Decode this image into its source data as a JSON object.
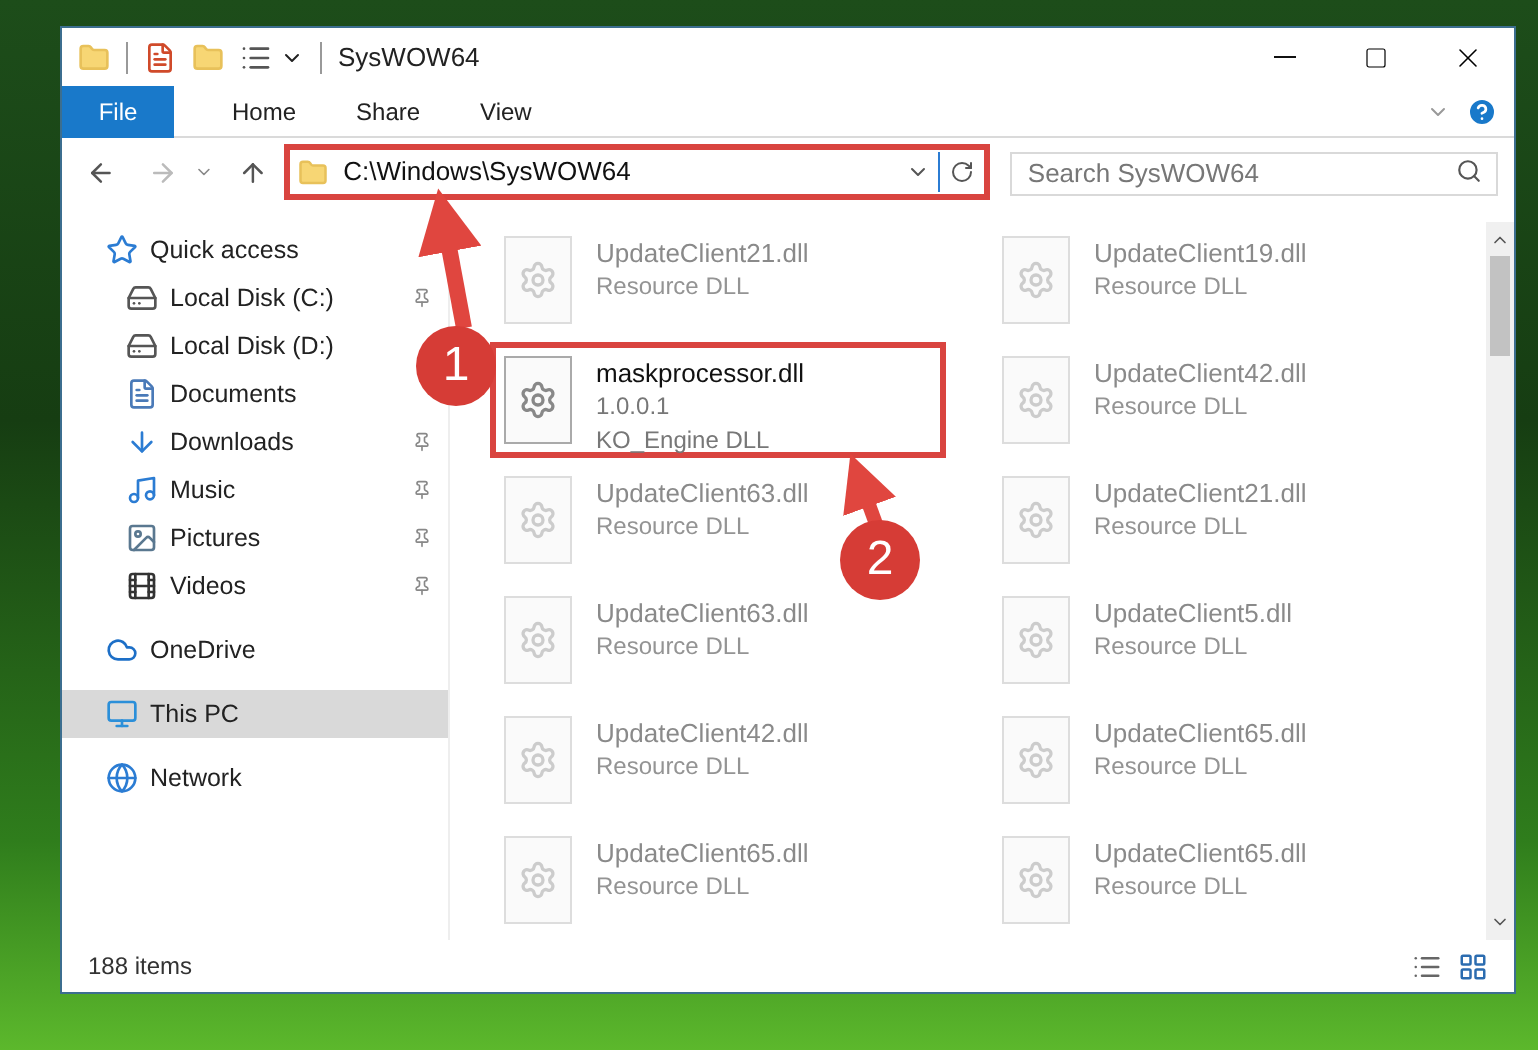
{
  "window": {
    "title": "SysWOW64"
  },
  "ribbon_tabs": [
    {
      "label": "File",
      "selected": true
    },
    {
      "label": "Home",
      "selected": false
    },
    {
      "label": "Share",
      "selected": false
    },
    {
      "label": "View",
      "selected": false
    }
  ],
  "address_bar": {
    "value": "C:\\Windows\\SysWOW64",
    "highlighted": true
  },
  "search": {
    "placeholder": "Search SysWOW64"
  },
  "sidebar": {
    "items": [
      {
        "label": "Quick access",
        "selected": false,
        "children": [
          {
            "label": "Local Disk (C:)",
            "selected": false,
            "pinned": true
          },
          {
            "label": "Local Disk (D:)",
            "selected": false,
            "pinned": false
          },
          {
            "label": "Documents",
            "selected": false,
            "pinned": false
          },
          {
            "label": "Downloads",
            "selected": false,
            "pinned": true
          },
          {
            "label": "Music",
            "selected": false,
            "pinned": true
          },
          {
            "label": "Pictures",
            "selected": false,
            "pinned": true
          },
          {
            "label": "Videos",
            "selected": false,
            "pinned": true
          }
        ]
      },
      {
        "label": "OneDrive",
        "selected": false
      },
      {
        "label": "This PC",
        "selected": true
      },
      {
        "label": "Network",
        "selected": false
      }
    ]
  },
  "files": [
    {
      "name": "UpdateClient21.dll",
      "lines": [
        "Resource DLL"
      ],
      "highlighted": false
    },
    {
      "name": "UpdateClient19.dll",
      "lines": [
        "Resource DLL"
      ],
      "highlighted": false
    },
    {
      "name": "maskprocessor.dll",
      "lines": [
        "1.0.0.1",
        "KO_Engine DLL"
      ],
      "highlighted": true
    },
    {
      "name": "UpdateClient42.dll",
      "lines": [
        "Resource DLL"
      ],
      "highlighted": false
    },
    {
      "name": "UpdateClient63.dll",
      "lines": [
        "Resource DLL"
      ],
      "highlighted": false
    },
    {
      "name": "UpdateClient21.dll",
      "lines": [
        "Resource DLL"
      ],
      "highlighted": false
    },
    {
      "name": "UpdateClient63.dll",
      "lines": [
        "Resource DLL"
      ],
      "highlighted": false
    },
    {
      "name": "UpdateClient5.dll",
      "lines": [
        "Resource DLL"
      ],
      "highlighted": false
    },
    {
      "name": "UpdateClient42.dll",
      "lines": [
        "Resource DLL"
      ],
      "highlighted": false
    },
    {
      "name": "UpdateClient65.dll",
      "lines": [
        "Resource DLL"
      ],
      "highlighted": false
    },
    {
      "name": "UpdateClient65.dll",
      "lines": [
        "Resource DLL"
      ],
      "highlighted": false
    },
    {
      "name": "UpdateClient65.dll",
      "lines": [
        "Resource DLL"
      ],
      "highlighted": false
    }
  ],
  "status_bar": {
    "item_count": "188 items"
  },
  "annotations": [
    {
      "number": "1"
    },
    {
      "number": "2"
    }
  ]
}
